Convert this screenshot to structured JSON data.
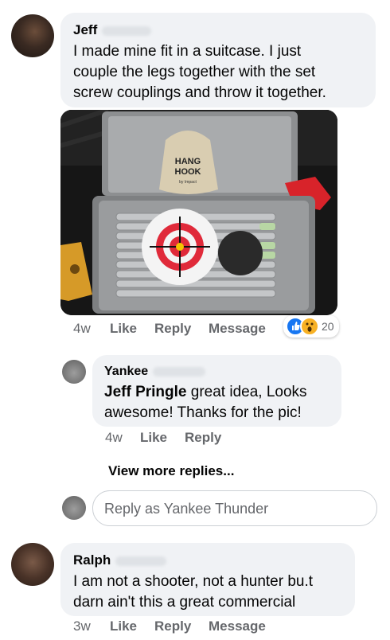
{
  "comments": [
    {
      "author": "Jeff",
      "lines": [
        "I made mine fit in a suitcase. I just",
        "couple the legs together with the set",
        "screw couplings and throw it together."
      ],
      "meta": {
        "time": "4w",
        "like": "Like",
        "reply": "Reply",
        "message": "Message",
        "reaction_count": "20"
      },
      "photo": {
        "bag_line1": "HANG",
        "bag_line2": "HOOK",
        "bag_line3": "by Impact"
      }
    },
    {
      "author": "Yankee",
      "mention": "Jeff Pringle",
      "text_after_mention": " great idea, Looks",
      "line2": "awesome! Thanks for the pic!",
      "meta": {
        "time": "4w",
        "like": "Like",
        "reply": "Reply"
      }
    },
    {
      "author": "Ralph",
      "lines": [
        "I am not a shooter, not a hunter bu.t",
        "darn ain't this a great commercial"
      ],
      "meta": {
        "time": "3w",
        "like": "Like",
        "reply": "Reply",
        "message": "Message"
      }
    }
  ],
  "view_more": "View more replies...",
  "reply_placeholder": "Reply as Yankee Thunder",
  "colors": {
    "like_blue": "#1877f2",
    "wow_yellow": "#f7b125",
    "target_red": "#e02a3a"
  }
}
